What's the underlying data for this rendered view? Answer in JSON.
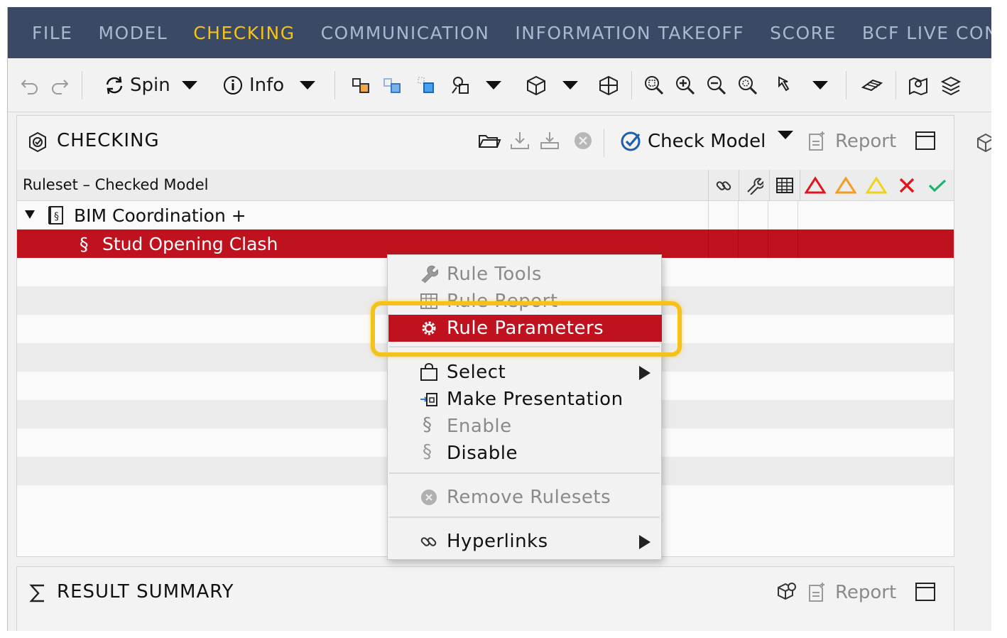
{
  "menubar": {
    "items": [
      {
        "label": "FILE",
        "active": false
      },
      {
        "label": "MODEL",
        "active": false
      },
      {
        "label": "CHECKING",
        "active": true
      },
      {
        "label": "COMMUNICATION",
        "active": false
      },
      {
        "label": "INFORMATION TAKEOFF",
        "active": false
      },
      {
        "label": "SCORE",
        "active": false
      },
      {
        "label": "BCF LIVE CONI",
        "active": false
      }
    ]
  },
  "toolbar": {
    "spin_label": "Spin",
    "info_label": "Info"
  },
  "checking_panel": {
    "title": "CHECKING",
    "check_model_label": "Check Model",
    "report_label": "Report",
    "column_title": "Ruleset – Checked Model",
    "tree": {
      "ruleset_label": "BIM Coordination +",
      "rule_label": "Stud Opening Clash"
    }
  },
  "context_menu": {
    "rule_tools": "Rule Tools",
    "rule_report": "Rule Report",
    "rule_parameters": "Rule Parameters",
    "select": "Select",
    "make_presentation": "Make Presentation",
    "enable": "Enable",
    "disable": "Disable",
    "remove_rulesets": "Remove Rulesets",
    "hyperlinks": "Hyperlinks"
  },
  "result_summary": {
    "title": "RESULT SUMMARY",
    "report_label": "Report"
  },
  "colors": {
    "menubar_bg": "#3b4a64",
    "menu_active": "#f6c21a",
    "selection_red": "#c0121e",
    "callout_yellow": "#f5c21a",
    "critical": "#e0161e",
    "major": "#f59b20",
    "moderate": "#f2d21a",
    "ok": "#1fb46b"
  }
}
